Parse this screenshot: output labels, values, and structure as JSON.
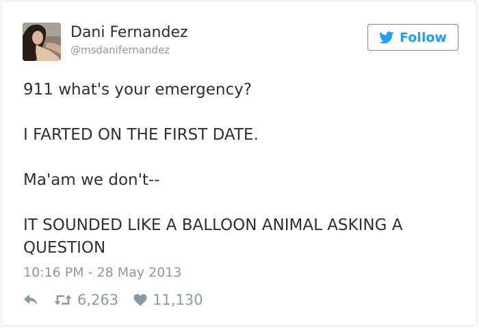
{
  "user": {
    "display_name": "Dani Fernandez",
    "handle": "@msdanifernandez",
    "avatar_icon": "profile-photo"
  },
  "follow_button": {
    "label": "Follow",
    "icon": "twitter-bird-icon",
    "color": "#1da1f2"
  },
  "tweet": {
    "lines": [
      "911 what's your emergency?",
      "I FARTED ON THE FIRST DATE.",
      "Ma'am we don't--",
      "IT SOUNDED LIKE A BALLOON ANIMAL ASKING A QUESTION"
    ],
    "timestamp": "10:16 PM - 28 May 2013"
  },
  "actions": {
    "reply_icon": "reply-icon",
    "retweet_icon": "retweet-icon",
    "retweet_count": "6,263",
    "like_icon": "heart-icon",
    "like_count": "11,130"
  },
  "colors": {
    "text": "#292f33",
    "secondary": "#8899a6",
    "border": "#e1e8ed"
  }
}
